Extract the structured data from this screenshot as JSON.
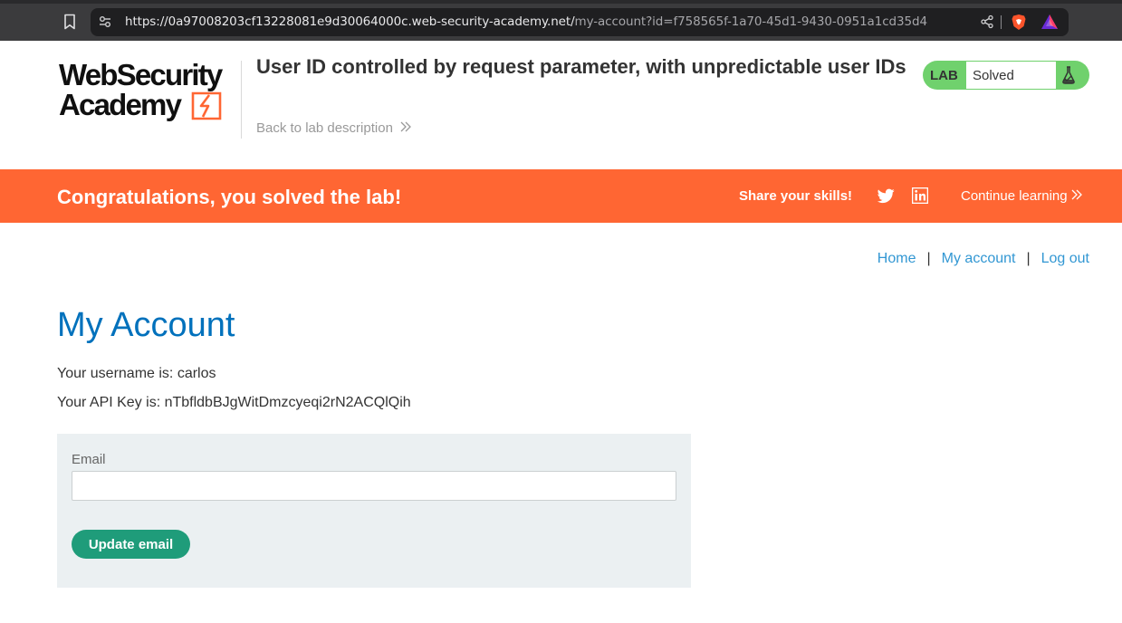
{
  "browser": {
    "url_host": "https://0a97008203cf13228081e9d30064000c.web-security-academy.net/",
    "url_path": "my-account?id=f758565f-1a70-45d1-9430-0951a1cd35d4"
  },
  "header": {
    "logo_line1": "WebSecurity",
    "logo_line2": "Academy",
    "lab_title": "User ID controlled by request parameter, with unpredictable user IDs",
    "back_link": "Back to lab description",
    "lab_badge_label": "LAB",
    "lab_badge_status": "Solved",
    "lab_badge_color": "#70d16d"
  },
  "banner": {
    "message": "Congratulations, you solved the lab!",
    "share_label": "Share your skills!",
    "continue_label": "Continue learning",
    "color": "#ff6633"
  },
  "nav": {
    "home": "Home",
    "my_account": "My account",
    "log_out": "Log out",
    "separator": "|"
  },
  "main": {
    "title": "My Account",
    "username_line": "Your username is: carlos",
    "apikey_line": "Your API Key is: nTbfldbBJgWitDmzcyeqi2rN2ACQlQih",
    "email_label": "Email",
    "email_value": "",
    "update_button": "Update email"
  },
  "icons": {
    "bookmark": "bookmark-icon",
    "site_settings": "site-settings-icon",
    "share": "share-icon",
    "brave": "brave-shield-icon",
    "rewards": "brave-rewards-icon",
    "flask": "flask-icon",
    "twitter": "twitter-icon",
    "linkedin": "linkedin-icon",
    "chevron": "double-chevron-right-icon"
  }
}
